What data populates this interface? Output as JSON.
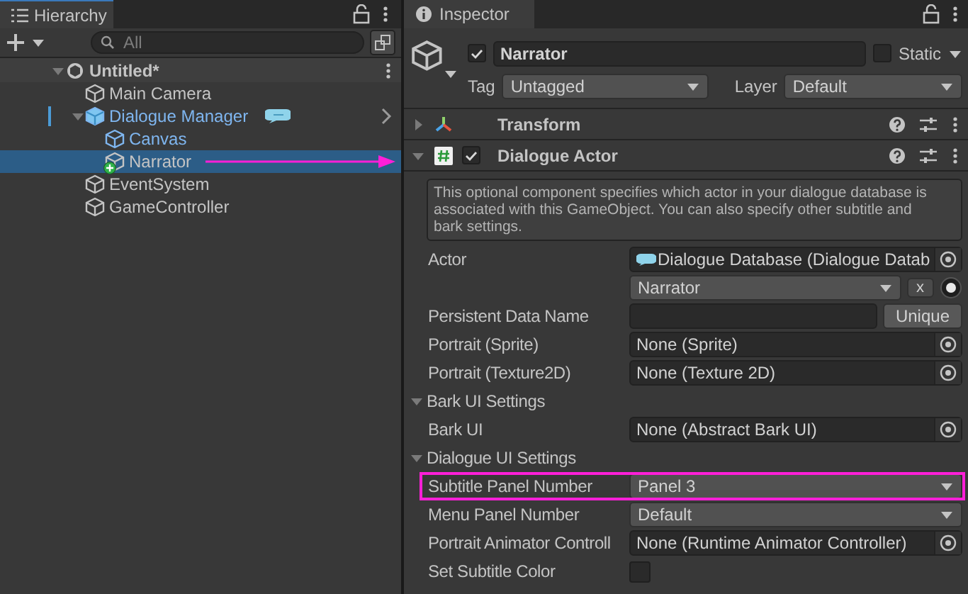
{
  "hierarchy": {
    "tab": "Hierarchy",
    "search": {
      "placeholder": "All"
    },
    "items": [
      {
        "name": "Untitled*",
        "kind": "scene",
        "expanded": true,
        "selected": false,
        "children": [
          {
            "name": "Main Camera",
            "kind": "object",
            "selected": false
          },
          {
            "name": "Dialogue Manager",
            "kind": "prefab",
            "expanded": true,
            "overridden": true,
            "badge": true,
            "selected": false,
            "children": [
              {
                "name": "Canvas",
                "kind": "prefab",
                "selected": false
              },
              {
                "name": "Narrator",
                "kind": "object",
                "added": true,
                "selected": true,
                "arrow": true
              }
            ]
          },
          {
            "name": "EventSystem",
            "kind": "object",
            "selected": false
          },
          {
            "name": "GameController",
            "kind": "object",
            "selected": false
          }
        ]
      }
    ]
  },
  "inspector": {
    "tab": "Inspector",
    "object": {
      "name": "Narrator",
      "active": true,
      "static": false,
      "static_label": "Static",
      "tag_label": "Tag",
      "tag": "Untagged",
      "layer_label": "Layer",
      "layer": "Default"
    },
    "components": [
      {
        "name": "Transform",
        "kind": "transform",
        "expanded": false
      },
      {
        "name": "Dialogue Actor",
        "kind": "script",
        "expanded": true,
        "enabled": true,
        "help": "This optional component specifies which actor in your dialogue database is associated with this GameObject. You can also specify other subtitle and bark settings.",
        "properties": [
          {
            "kind": "object",
            "label": "Actor",
            "value": "Dialogue Database (Dialogue Datab",
            "icon": true
          },
          {
            "kind": "actor-popup",
            "value": "Narrator",
            "button": "x"
          },
          {
            "kind": "text-button",
            "label": "Persistent Data Name",
            "button": "Unique"
          },
          {
            "kind": "object",
            "label": "Portrait (Sprite)",
            "value": "None (Sprite)"
          },
          {
            "kind": "object",
            "label": "Portrait (Texture2D)",
            "value": "None (Texture 2D)"
          },
          {
            "kind": "section",
            "label": "Bark UI Settings",
            "expanded": true
          },
          {
            "kind": "object",
            "label": "Bark UI",
            "value": "None (Abstract Bark UI)"
          },
          {
            "kind": "section",
            "label": "Dialogue UI Settings",
            "expanded": true
          },
          {
            "kind": "popup",
            "label": "Subtitle Panel Number",
            "value": "Panel 3",
            "highlighted": true
          },
          {
            "kind": "popup",
            "label": "Menu Panel Number",
            "value": "Default",
            "highlighted": false
          },
          {
            "kind": "object",
            "label": "Portrait Animator Controll",
            "value": "None (Runtime Animator Controller)"
          },
          {
            "kind": "checkbox",
            "label": "Set Subtitle Color",
            "checked": false
          }
        ]
      }
    ]
  }
}
